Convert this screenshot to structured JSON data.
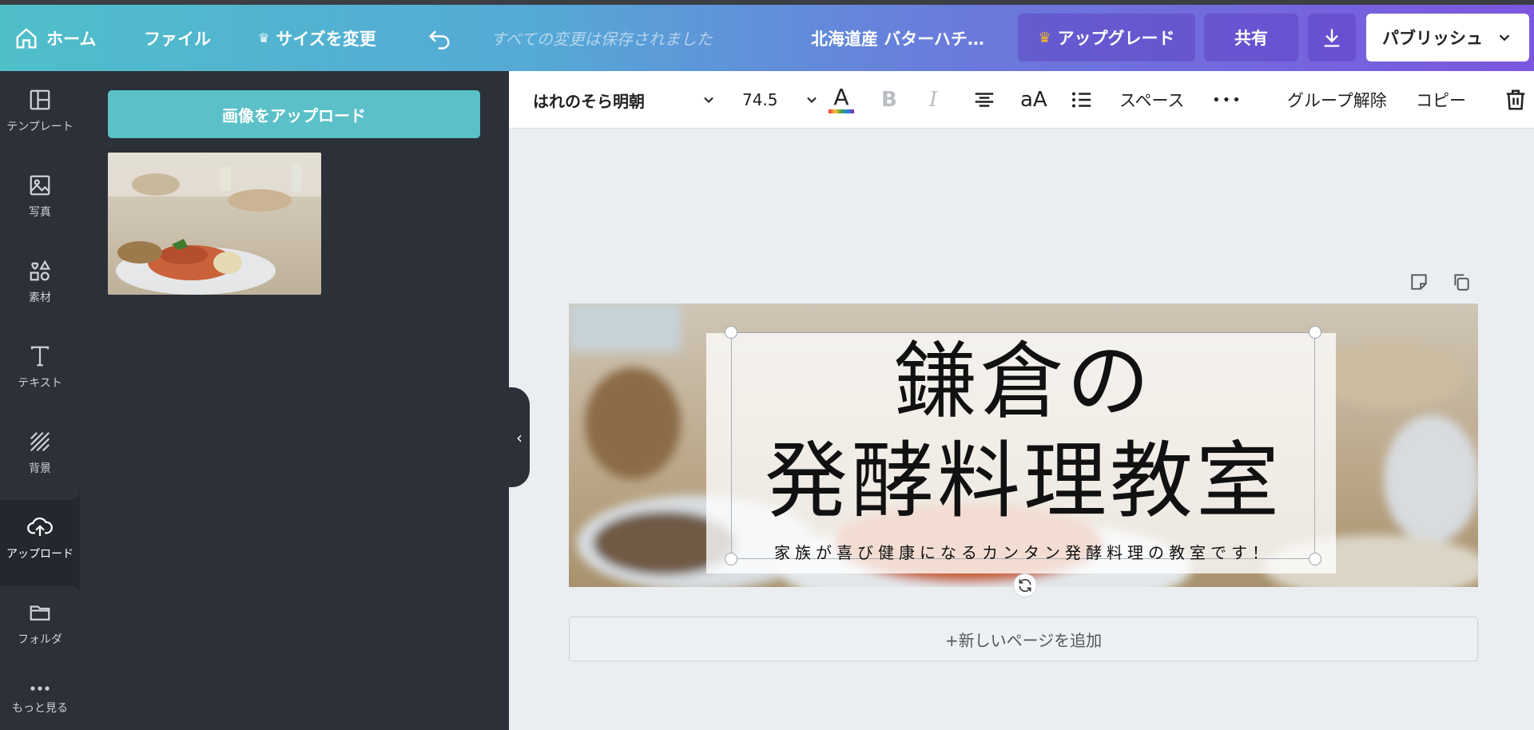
{
  "header": {
    "home_label": "ホーム",
    "file_label": "ファイル",
    "resize_label": "サイズを変更",
    "saved_status": "すべての変更は保存されました",
    "doc_title": "北海道産 バターハチ…",
    "upgrade_label": "アップグレード",
    "share_label": "共有",
    "publish_label": "パブリッシュ"
  },
  "rail": {
    "items": [
      {
        "label": "テンプレート",
        "icon": "template-icon"
      },
      {
        "label": "写真",
        "icon": "photo-icon"
      },
      {
        "label": "素材",
        "icon": "elements-icon"
      },
      {
        "label": "テキスト",
        "icon": "text-icon"
      },
      {
        "label": "背景",
        "icon": "background-icon"
      },
      {
        "label": "アップロード",
        "icon": "upload-icon"
      },
      {
        "label": "フォルダ",
        "icon": "folder-icon"
      },
      {
        "label": "もっと見る",
        "icon": "more-icon"
      }
    ],
    "active": "アップロード"
  },
  "panel": {
    "upload_button": "画像をアップロード",
    "collapse_glyph": "‹"
  },
  "toolbar": {
    "font_name": "はれのそら明朝",
    "font_size": "74.5",
    "bold": "B",
    "italic": "I",
    "case": "aA",
    "spacing": "スペース",
    "more": "•••",
    "ungroup": "グループ解除",
    "copy": "コピー",
    "text_color_glyph": "A"
  },
  "canvas": {
    "title_line1": "鎌倉の",
    "title_line2": "発酵料理教室",
    "subtitle": "家族が喜び健康になるカンタン発酵料理の教室です！",
    "add_page": "+新しいページを追加"
  },
  "colors": {
    "upload_button": "#5bc0c8",
    "panel": "#2b3039",
    "gradient_start": "#4fbfc9",
    "gradient_end": "#7c56df",
    "crown": "#f5b82e"
  }
}
